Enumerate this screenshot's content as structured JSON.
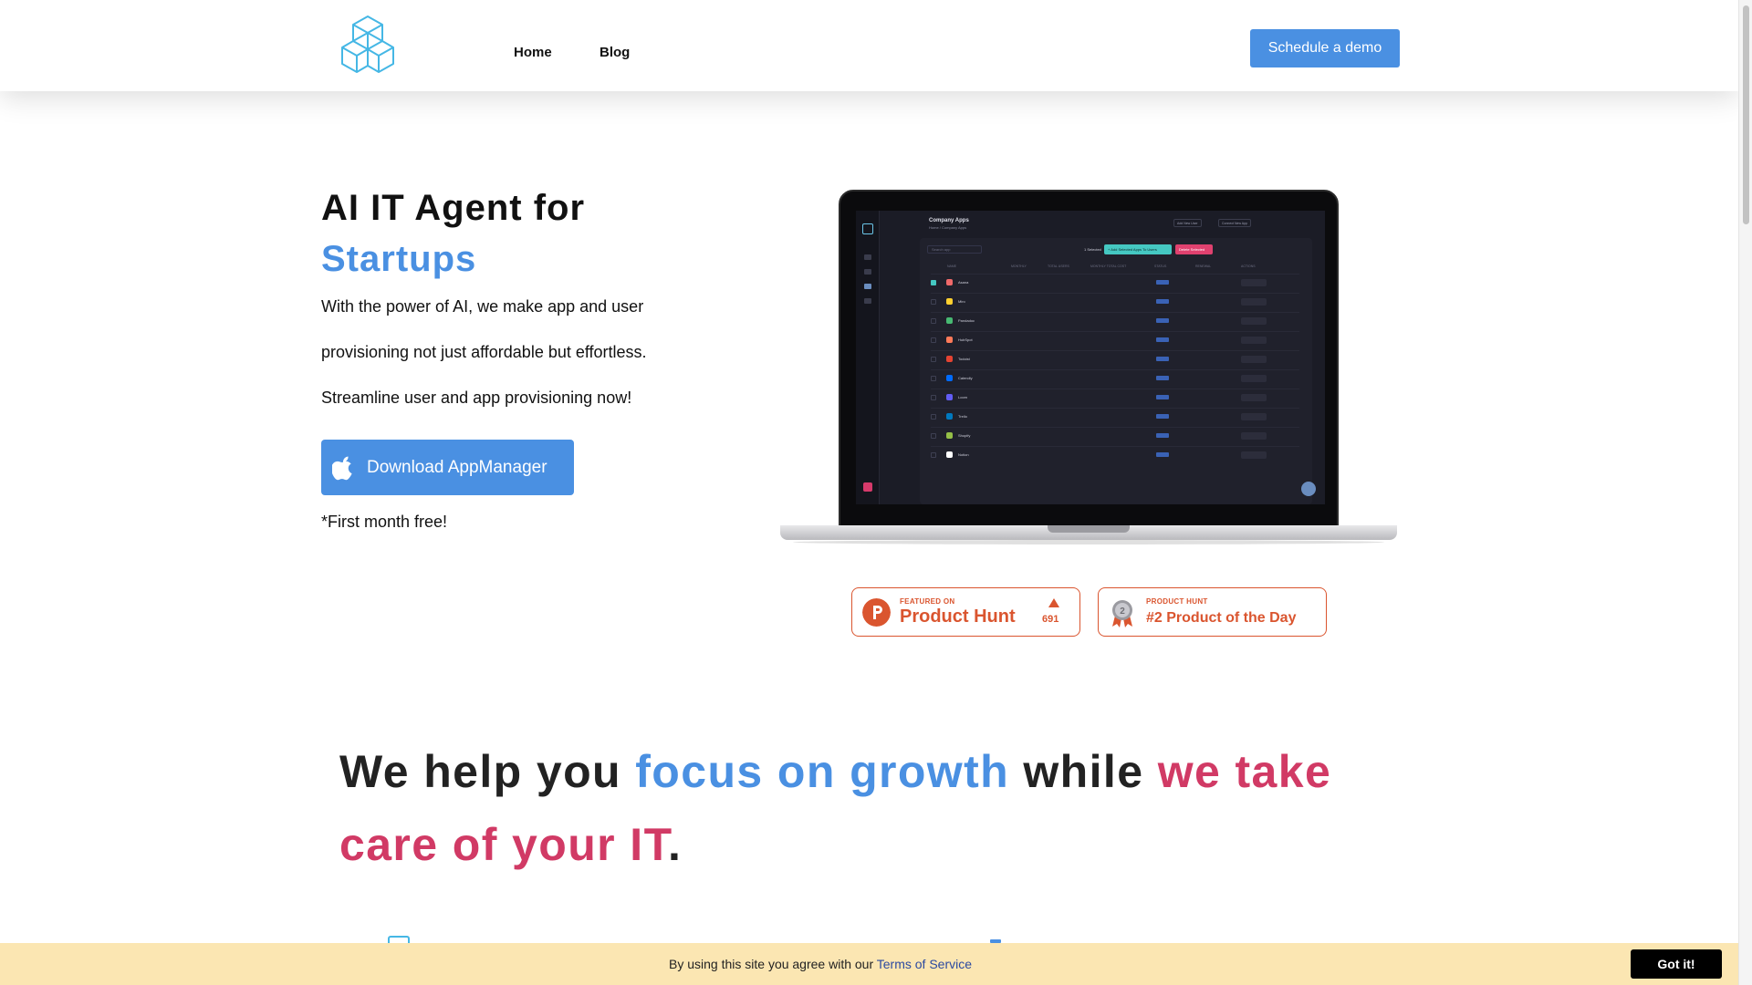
{
  "header": {
    "logo_icon": "isometric-cubes-logo",
    "nav": [
      {
        "label": "Home"
      },
      {
        "label": "Blog"
      }
    ],
    "cta_label": "Schedule a demo",
    "accent_color": "#4a90e2"
  },
  "hero": {
    "title_line1": "AI IT Agent for",
    "title_line2": "Startups",
    "paragraph_line1": "With the power of AI, we make app and user",
    "paragraph_line2": "provisioning not just affordable but effortless.",
    "paragraph_line3": "Streamline user and app provisioning now!",
    "download_label": "Download AppManager",
    "download_icon": "apple-icon",
    "free_note": "*First month free!"
  },
  "app_screenshot": {
    "title": "Company Apps",
    "breadcrumb": "Home / Company Apps",
    "header_buttons": [
      "Add New User",
      "Connect New App"
    ],
    "search_placeholder": "Search app",
    "selected_text": "1 Selected",
    "add_button": "+ Add Selected Apps To Users",
    "delete_button": "Delete Selected",
    "columns": [
      "NAME",
      "MONTHLY",
      "TOTAL USERS",
      "MONTHLY TOTAL COST",
      "STATUS",
      "RENEWAL",
      "ACTIONS"
    ],
    "rows": [
      {
        "name": "Asana",
        "color": "#f06a6a",
        "checked": true
      },
      {
        "name": "Miro",
        "color": "#ffd02f",
        "checked": false
      },
      {
        "name": "Pandadoc",
        "color": "#47b972",
        "checked": false
      },
      {
        "name": "HubSpot",
        "color": "#ff7a59",
        "checked": false
      },
      {
        "name": "Todoist",
        "color": "#e44332",
        "checked": false
      },
      {
        "name": "Calendly",
        "color": "#006bff",
        "checked": false
      },
      {
        "name": "Loom",
        "color": "#625df5",
        "checked": false
      },
      {
        "name": "Trello",
        "color": "#0079bf",
        "checked": false
      },
      {
        "name": "Shopify",
        "color": "#95bf47",
        "checked": false
      },
      {
        "name": "Notion",
        "color": "#ffffff",
        "checked": false
      }
    ],
    "chat_icon": "chat-bubble-icon"
  },
  "badges": {
    "ph_featured": {
      "small": "FEATURED ON",
      "big": "Product Hunt",
      "count": "691",
      "icon": "product-hunt-icon",
      "color": "#da552f"
    },
    "ph_award": {
      "small": "PRODUCT HUNT",
      "big": "#2 Product of the Day",
      "icon": "medal-icon"
    }
  },
  "tagline": {
    "part1": "We help you ",
    "part2": "focus on growth",
    "part3": " while ",
    "part4": "we take care of your IT",
    "part5": ".",
    "blue": "#4a90e2",
    "red": "#d13a65"
  },
  "cookie": {
    "text": "By using this site you agree with our ",
    "link": "Terms of Service",
    "button": "Got it!",
    "background": "#fbe6b2"
  }
}
